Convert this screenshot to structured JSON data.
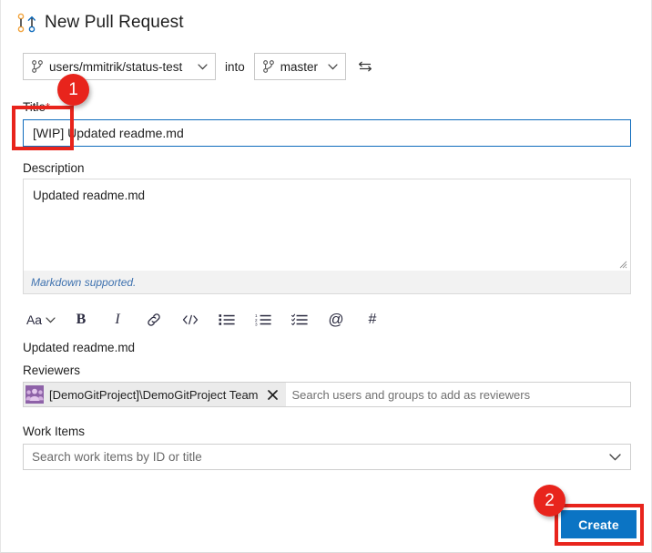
{
  "header": {
    "title": "New Pull Request",
    "icon": "pull-request-icon"
  },
  "branches": {
    "source_branch": "users/mmitrik/status-test",
    "into_label": "into",
    "target_branch": "master",
    "swap_icon": "swap-branches-icon",
    "branch_icon": "git-branch-icon",
    "chevron_icon": "chevron-down-icon"
  },
  "title_field": {
    "label": "Title",
    "required_marker": "*",
    "value": "[WIP] Updated readme.md"
  },
  "description": {
    "label": "Description",
    "value": "Updated readme.md",
    "markdown_note": "Markdown supported.",
    "resize_icon": "resize-grip-icon"
  },
  "format_toolbar": {
    "items": [
      {
        "name": "font-style-dropdown",
        "label": "Aa",
        "icon": "chevron-down-icon"
      },
      {
        "name": "bold-button",
        "label": "B",
        "icon": "bold-icon"
      },
      {
        "name": "italic-button",
        "label": "I",
        "icon": "italic-icon"
      },
      {
        "name": "link-button",
        "label": "",
        "icon": "link-icon"
      },
      {
        "name": "code-button",
        "label": "",
        "icon": "code-icon"
      },
      {
        "name": "bullet-list-button",
        "label": "",
        "icon": "bullet-list-icon"
      },
      {
        "name": "numbered-list-button",
        "label": "",
        "icon": "numbered-list-icon"
      },
      {
        "name": "task-list-button",
        "label": "",
        "icon": "task-list-icon"
      },
      {
        "name": "mention-button",
        "label": "@",
        "icon": "mention-icon"
      },
      {
        "name": "hash-button",
        "label": "#",
        "icon": "hash-icon"
      }
    ]
  },
  "preview": {
    "text": "Updated readme.md"
  },
  "reviewers": {
    "label": "Reviewers",
    "chip": {
      "name": "[DemoGitProject]\\DemoGitProject Team",
      "avatar_icon": "team-avatar-icon",
      "remove_icon": "close-icon"
    },
    "placeholder": "Search users and groups to add as reviewers"
  },
  "work_items": {
    "label": "Work Items",
    "placeholder": "Search work items by ID or title",
    "chevron_icon": "chevron-down-icon"
  },
  "actions": {
    "create_label": "Create"
  },
  "annotations": {
    "badge_one": "1",
    "badge_two": "2",
    "color": "#e8241c"
  },
  "colors": {
    "accent_blue": "#0b74c4",
    "focus_border": "#0f6cbd",
    "annotation_red": "#e8241c",
    "link_blue": "#3f72af",
    "avatar_purple": "#8e62a8"
  }
}
